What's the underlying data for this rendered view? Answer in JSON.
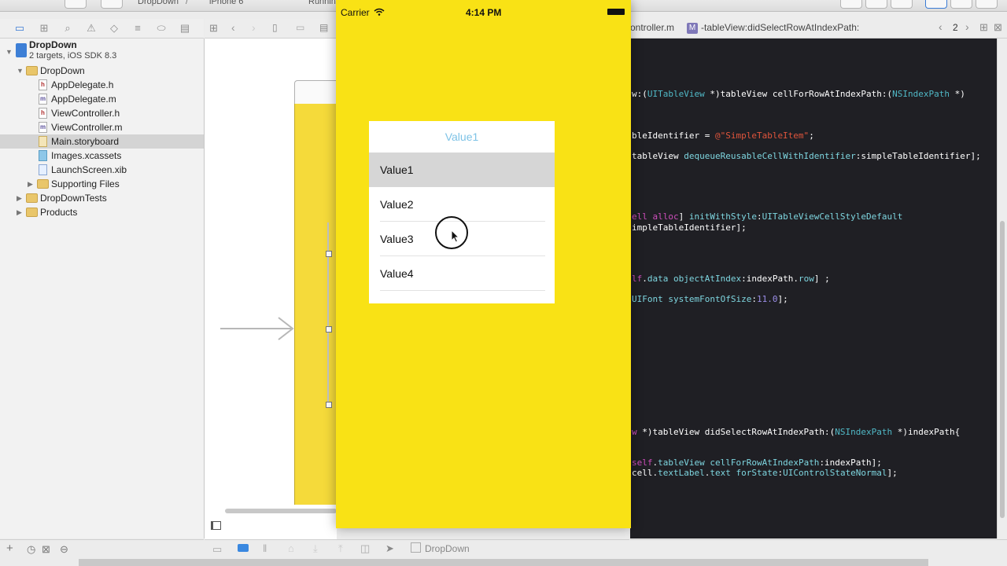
{
  "toolbar": {
    "scheme_label": "DropDown",
    "device_label": "iPhone 6",
    "status_label": "Runnin"
  },
  "navigator": {
    "project": {
      "name": "DropDown",
      "subtitle": "2 targets, iOS SDK 8.3"
    },
    "items": [
      {
        "label": "DropDown",
        "kind": "folder"
      },
      {
        "label": "AppDelegate.h",
        "kind": "h"
      },
      {
        "label": "AppDelegate.m",
        "kind": "m"
      },
      {
        "label": "ViewController.h",
        "kind": "h"
      },
      {
        "label": "ViewController.m",
        "kind": "m"
      },
      {
        "label": "Main.storyboard",
        "kind": "storyboard",
        "selected": true
      },
      {
        "label": "Images.xcassets",
        "kind": "xcassets"
      },
      {
        "label": "LaunchScreen.xib",
        "kind": "xib"
      },
      {
        "label": "Supporting Files",
        "kind": "folder"
      },
      {
        "label": "DropDownTests",
        "kind": "folder"
      },
      {
        "label": "Products",
        "kind": "folder"
      }
    ]
  },
  "editor": {
    "jump_file": "ontroller.m",
    "jump_method": "-tableView:didSelectRowAtIndexPath:",
    "counterpart_count": "2"
  },
  "simulator": {
    "carrier": "Carrier",
    "time": "4:14 PM",
    "dropdown": {
      "header_value": "Value1",
      "options": [
        "Value1",
        "Value2",
        "Value3",
        "Value4"
      ],
      "highlighted_index": 0
    }
  },
  "canvas_bottom": {
    "scheme_label": "DropDown"
  },
  "colors": {
    "simulator_background": "#f9e215",
    "editor_background": "#1f1f24",
    "dropdown_header_text": "#7ec3e6",
    "highlight_row": "#d6d6d6"
  }
}
